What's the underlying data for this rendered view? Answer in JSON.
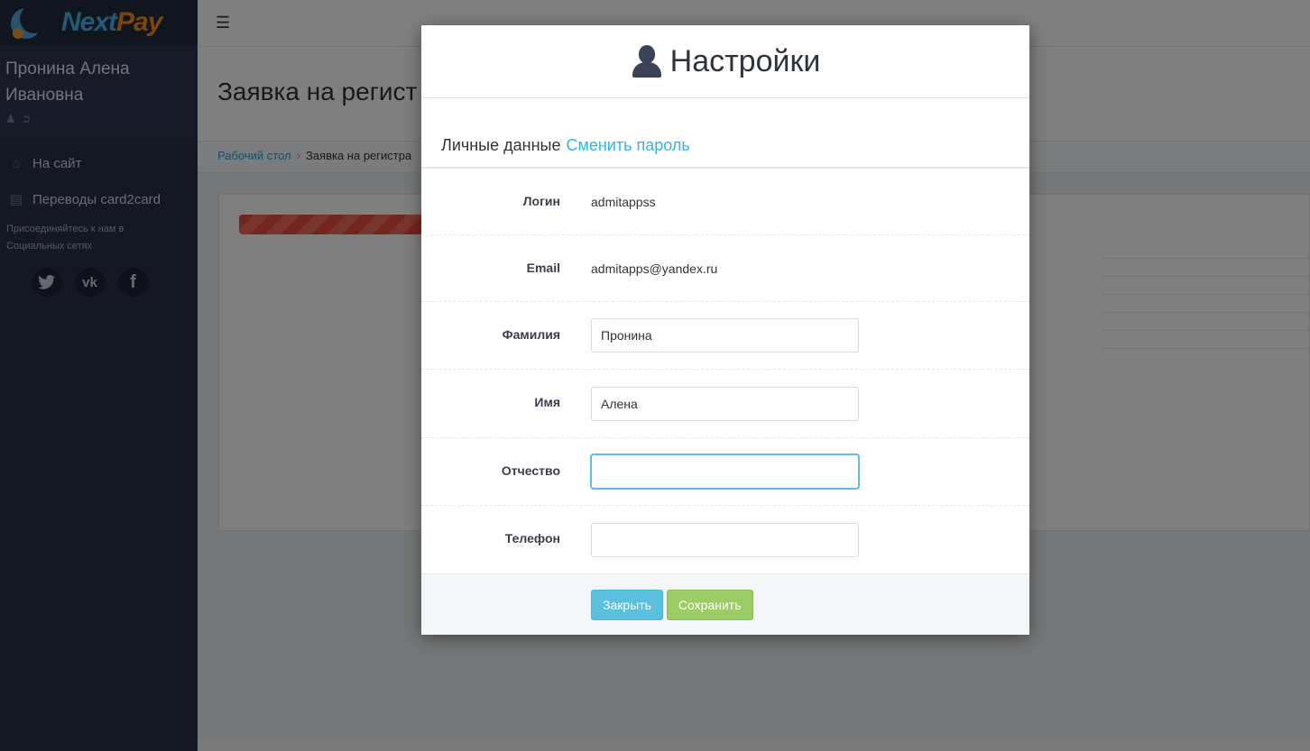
{
  "app": {
    "brand_part1": "Next",
    "brand_part2": "Pay"
  },
  "sidebar": {
    "user_name_line1": "Пронина Алена",
    "user_name_line2": "Ивановна",
    "items": [
      {
        "label": "На сайт",
        "icon": "home-icon"
      },
      {
        "label": "Переводы card2card",
        "icon": "card-icon"
      }
    ],
    "social_text_line1": "Присоединяйтесь к нам в",
    "social_text_line2": "Социальных сетях",
    "social": [
      {
        "icon": "twitter-icon"
      },
      {
        "icon": "vk-icon"
      },
      {
        "icon": "facebook-icon"
      }
    ]
  },
  "page": {
    "title": "Заявка на регист",
    "breadcrumb_home": "Рабочий стол",
    "breadcrumb_current": "Заявка на регистра"
  },
  "modal": {
    "title": "Настройки",
    "tab_active": "Личные данные",
    "tab_other": "Сменить пароль",
    "login_label": "Логин",
    "login_value": "admitappss",
    "email_label": "Email",
    "email_value": "admitapps@yandex.ru",
    "lastname_label": "Фамилия",
    "lastname_value": "Пронина",
    "firstname_label": "Имя",
    "firstname_value": "Алена",
    "middlename_label": "Отчество",
    "middlename_value": "",
    "phone_label": "Телефон",
    "phone_value": "",
    "close_label": "Закрыть",
    "save_label": "Сохранить"
  },
  "colors": {
    "sidebar": "#283046",
    "accent_link": "#2fb7e0",
    "close_button": "#5bc0de",
    "save_button": "#9ccc65"
  }
}
